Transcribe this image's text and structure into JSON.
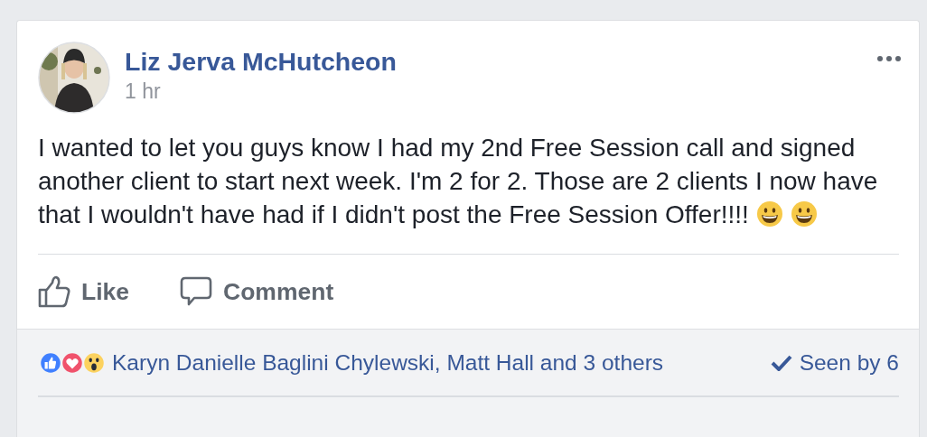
{
  "post": {
    "author": "Liz Jerva McHutcheon",
    "time": "1 hr",
    "body": "I wanted to let you guys know I had my 2nd Free Session call and signed another client to start next week. I'm 2 for 2. Those are 2 clients I now have that I wouldn't have had if I didn't post the Free Session Offer!!!!",
    "emojis": [
      {
        "kind": "grinning"
      },
      {
        "kind": "grinning"
      }
    ],
    "actions": [
      {
        "kind": "like",
        "label": "Like"
      },
      {
        "kind": "comment",
        "label": "Comment"
      }
    ],
    "reactions": [
      {
        "kind": "like"
      },
      {
        "kind": "love"
      },
      {
        "kind": "wow"
      }
    ],
    "reacted_by": "Karyn Danielle Baglini Chylewski, Matt Hall and 3 others",
    "seen_by": "Seen by 6"
  }
}
